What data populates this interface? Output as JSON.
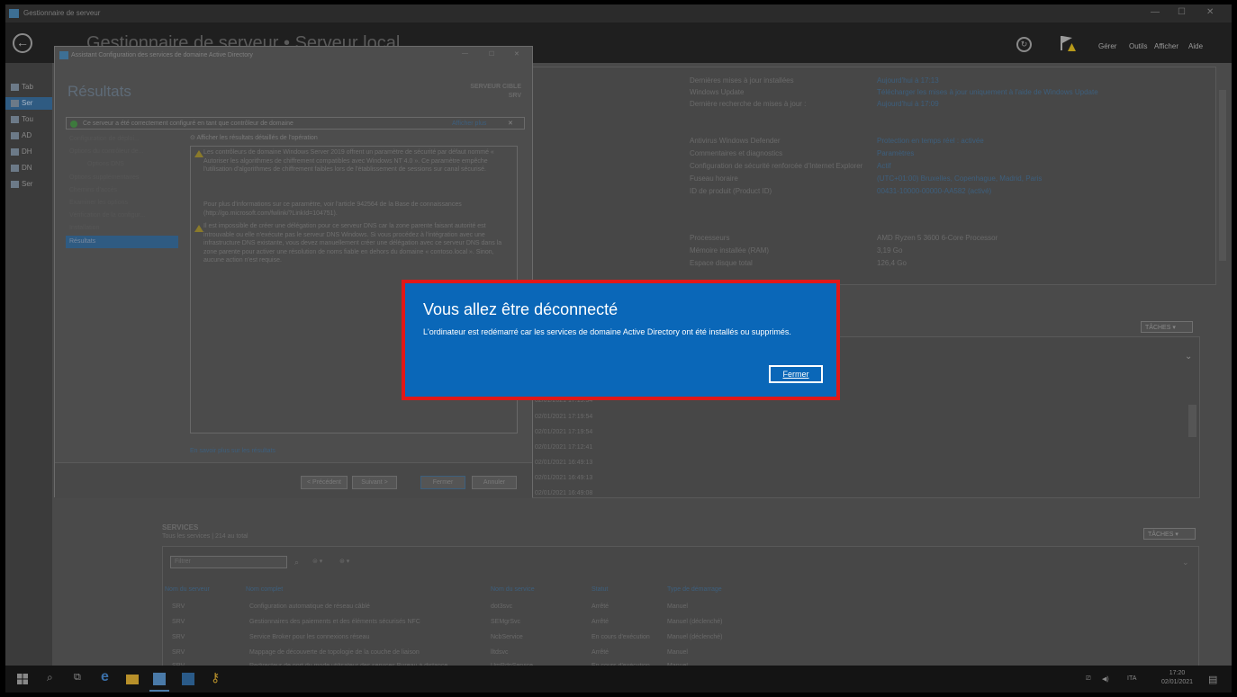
{
  "window": {
    "title": "Gestionnaire de serveur"
  },
  "header": {
    "title": "Gestionnaire de serveur • Serveur local",
    "menu": [
      "Gérer",
      "Outils",
      "Afficher",
      "Aide"
    ]
  },
  "left_nav": {
    "items": [
      "Tab",
      "Ser",
      "Tou",
      "AD",
      "DH",
      "DN",
      "Ser"
    ]
  },
  "properties": {
    "group1": [
      {
        "label": "Dernières mises à jour installées",
        "value": "Aujourd'hui à 17:13"
      },
      {
        "label": "Windows Update",
        "value": "Télécharger les mises à jour uniquement à l'aide de Windows Update"
      },
      {
        "label": "Dernière recherche de mises à jour :",
        "value": "Aujourd'hui à 17:09"
      }
    ],
    "group2": [
      {
        "label": "Antivirus Windows Defender",
        "value": "Protection en temps réel : activée"
      },
      {
        "label": "Commentaires et diagnostics",
        "value": "Paramètres"
      },
      {
        "label": "Configuration de sécurité renforcée d'Internet Explorer",
        "value": "Actif"
      },
      {
        "label": "Fuseau horaire",
        "value": "(UTC+01:00) Bruxelles, Copenhague, Madrid, Paris"
      },
      {
        "label": "ID de produit (Product ID)",
        "value": "00431-10000-00000-AA582 (activé)"
      }
    ],
    "group3": [
      {
        "label": "Processeurs",
        "value": "AMD Ryzen 5 3600 6-Core Processor"
      },
      {
        "label": "Mémoire installée (RAM)",
        "value": "3,19 Go"
      },
      {
        "label": "Espace disque total",
        "value": "126,4 Go"
      }
    ]
  },
  "taches_label": "TÂCHES",
  "events": {
    "timestamps": [
      "02/01/2021 17:19:54",
      "02/01/2021 17:19:54",
      "02/01/2021 17:19:54",
      "02/01/2021 17:12:41",
      "02/01/2021 16:49:13",
      "02/01/2021 16:49:13",
      "02/01/2021 16:49:08"
    ]
  },
  "wizard": {
    "title": "Assistant Configuration des services de domaine Active Directory",
    "heading": "Résultats",
    "target_label": "SERVEUR CIBLE",
    "target_value": "SRV",
    "banner_message": "Ce serveur a été correctement configuré en tant que contrôleur de domaine",
    "banner_more": "Afficher plus",
    "steps": [
      "Configuration de déploi...",
      "Options du contrôleur de...",
      "Options DNS",
      "Options supplémentaires",
      "Chemins d'accès",
      "Examiner les options",
      "Vérification de la configur...",
      "Installation",
      "Résultats"
    ],
    "details_header": "Afficher les résultats détaillés de l'opération",
    "warning1": "Les contrôleurs de domaine Windows Server 2019 offrent un paramètre de sécurité par défaut nommé « Autoriser les algorithmes de chiffrement compatibles avec Windows NT 4.0 ». Ce paramètre empêche l'utilisation d'algorithmes de chiffrement faibles lors de l'établissement de sessions sur canal sécurisé.",
    "info1": "Pour plus d'informations sur ce paramètre, voir l'article 942564 de la Base de connaissances (http://go.microsoft.com/fwlink/?LinkId=104751).",
    "warning2": "Il est impossible de créer une délégation pour ce serveur DNS car la zone parente faisant autorité est introuvable ou elle n'exécute pas le serveur DNS Windows. Si vous procédez à l'intégration avec une infrastructure DNS existante, vous devez manuellement créer une délégation avec ce serveur DNS dans la zone parente pour activer une résolution de noms fiable en dehors du domaine « contoso.local ». Sinon, aucune action n'est requise.",
    "learn_more": "En savoir plus sur les résultats",
    "buttons": {
      "prev": "< Précédent",
      "next": "Suivant >",
      "close": "Fermer",
      "cancel": "Annuler"
    }
  },
  "services": {
    "heading": "SERVICES",
    "subtitle": "Tous les services | 214 au total",
    "filter_placeholder": "Filtrer",
    "columns": [
      "Nom du serveur",
      "Nom complet",
      "Nom du service",
      "Statut",
      "Type de démarrage"
    ],
    "rows": [
      [
        "SRV",
        "Configuration automatique de réseau câblé",
        "dot3svc",
        "Arrêté",
        "Manuel"
      ],
      [
        "SRV",
        "Gestionnaires des paiements et des éléments sécurisés NFC",
        "SEMgrSvc",
        "Arrêté",
        "Manuel (déclenché)"
      ],
      [
        "SRV",
        "Service Broker pour les connexions réseau",
        "NcbService",
        "En cours d'exécution",
        "Manuel (déclenché)"
      ],
      [
        "SRV",
        "Mappage de découverte de topologie de la couche de liaison",
        "lltdsvc",
        "Arrêté",
        "Manuel"
      ],
      [
        "SRV",
        "Redirecteur de port du mode utilisateur des services Bureau à distance",
        "UmRdpService",
        "En cours d'exécution",
        "Manuel"
      ]
    ]
  },
  "notice": {
    "title": "Vous allez être déconnecté",
    "message": "L'ordinateur est redémarré car les services de domaine Active Directory ont été installés ou supprimés.",
    "button": "Fermer"
  },
  "taskbar": {
    "lang": "ITA",
    "time": "17:20",
    "date": "02/01/2021"
  }
}
